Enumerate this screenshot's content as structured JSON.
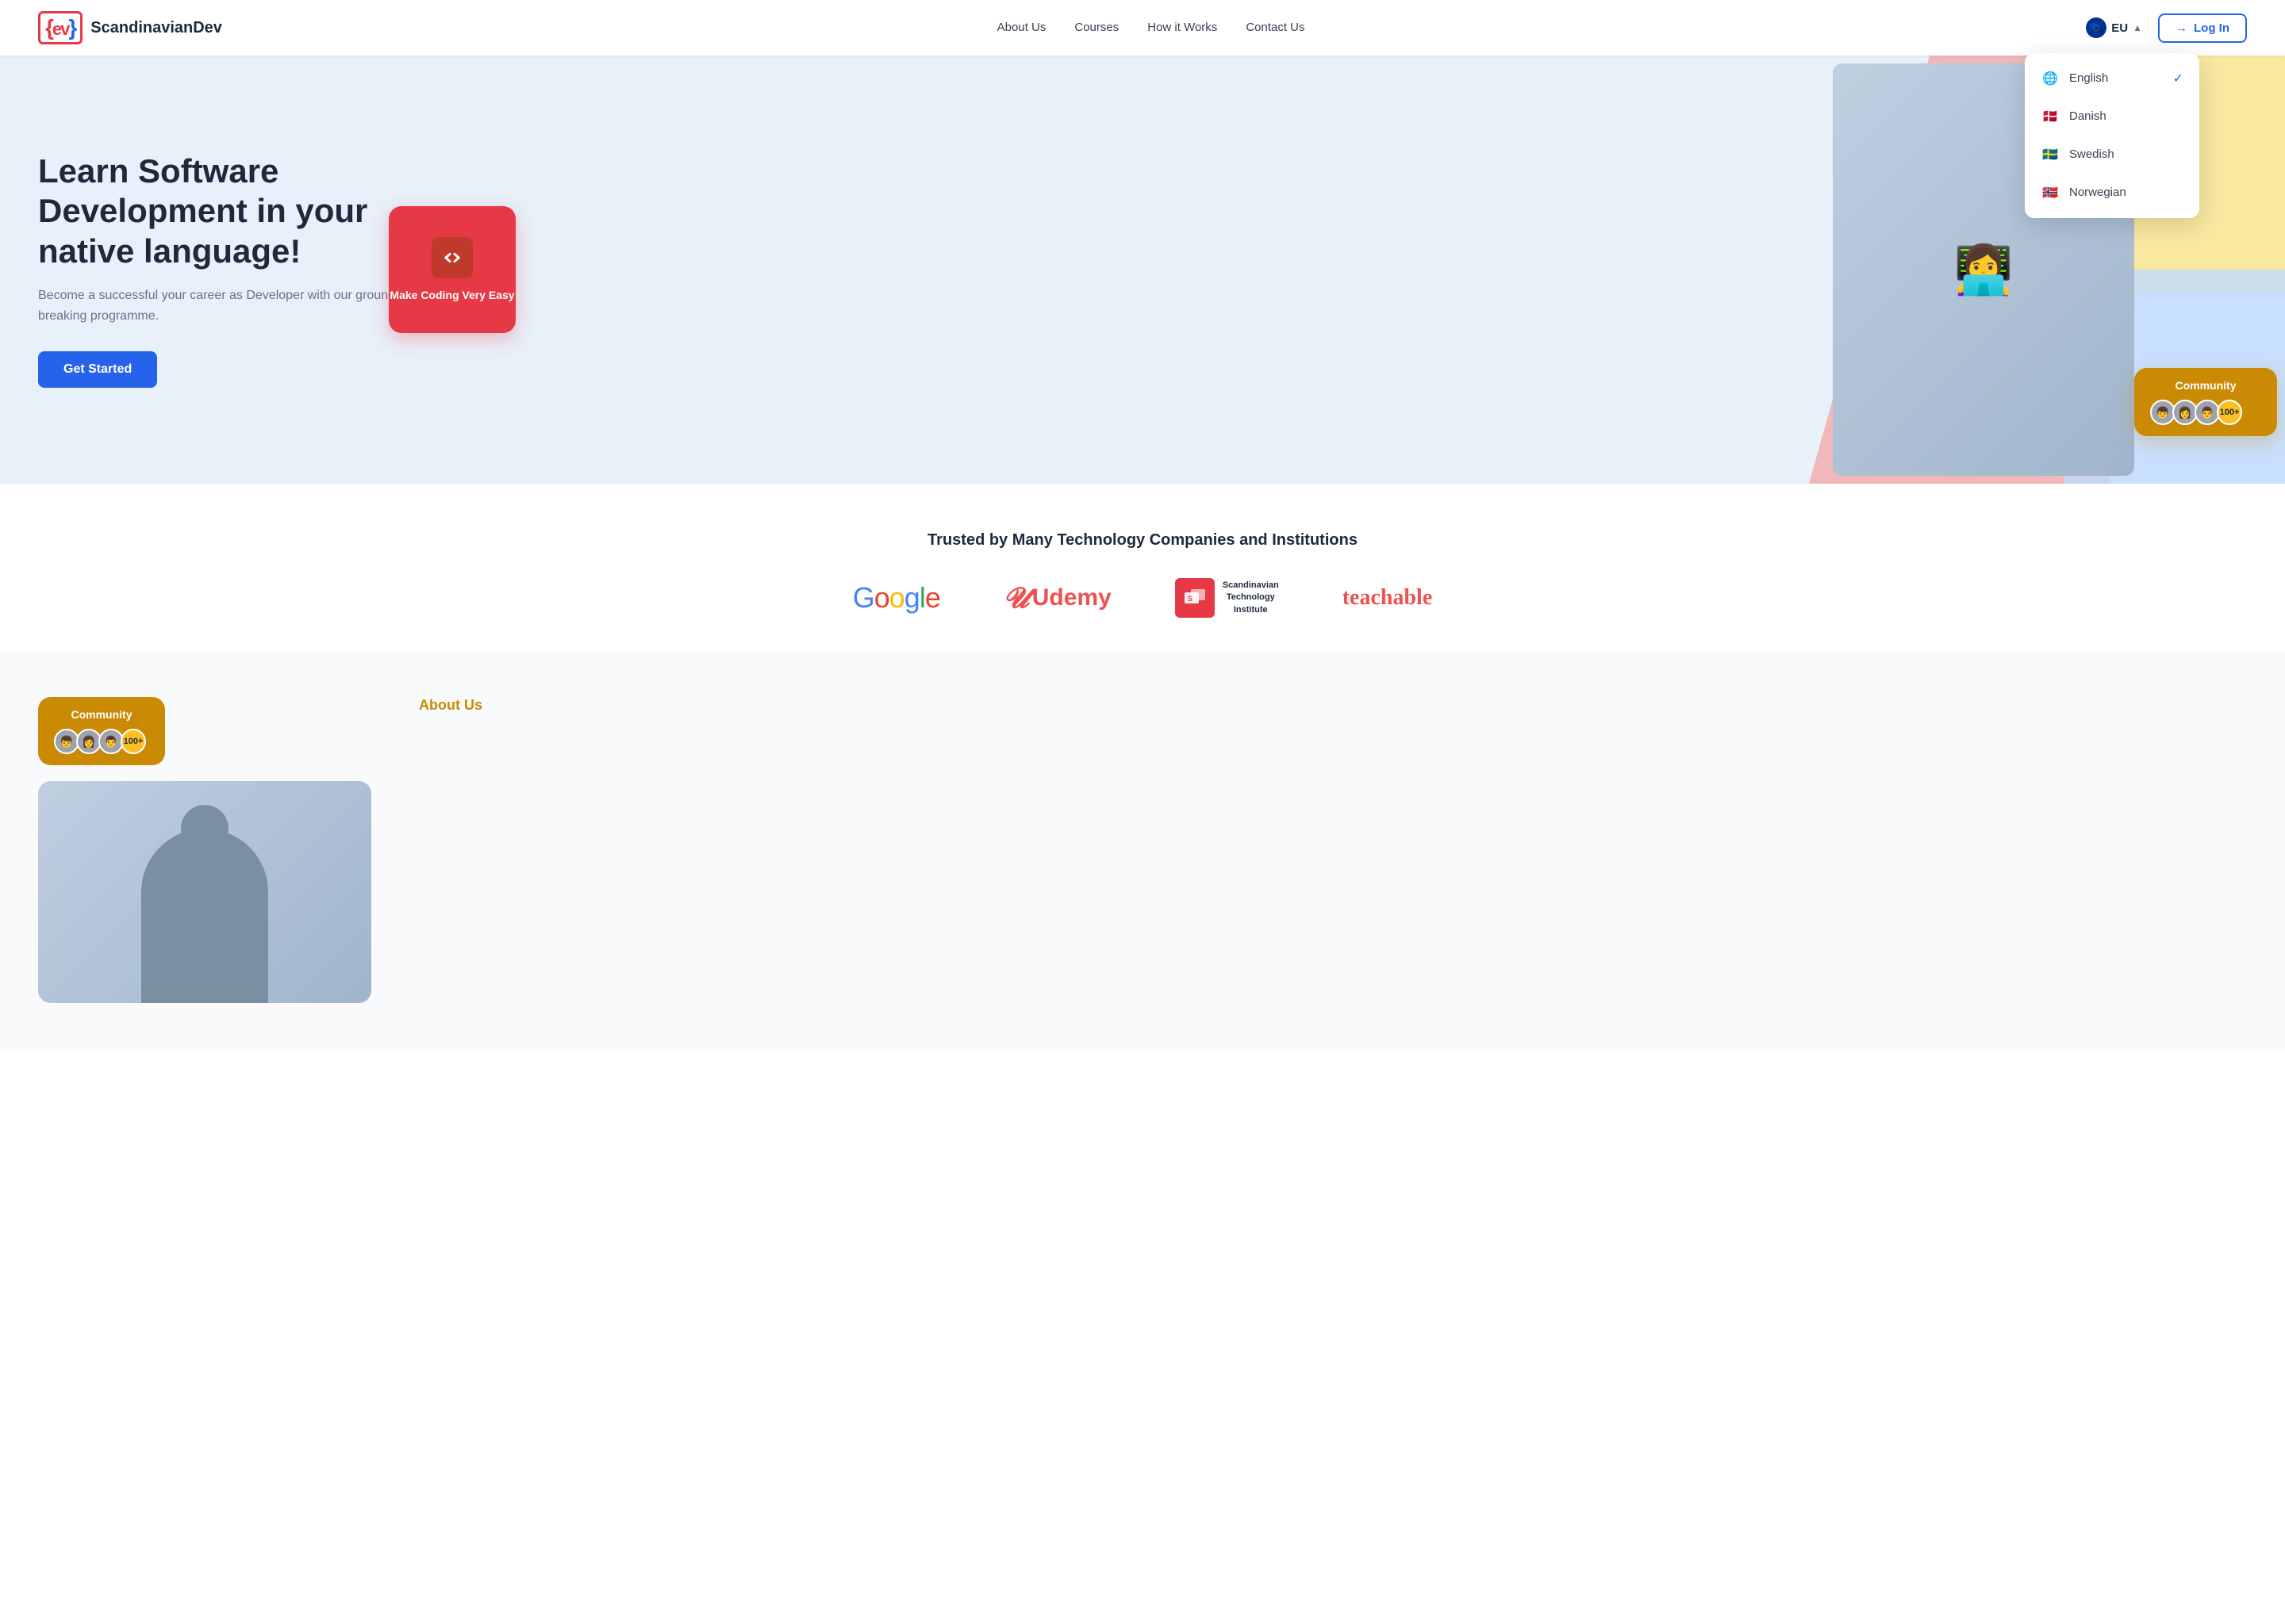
{
  "brand": {
    "name": "ScandinavianDev",
    "logo_icon": "{ev}"
  },
  "navbar": {
    "links": [
      {
        "label": "About Us",
        "id": "about-us"
      },
      {
        "label": "Courses",
        "id": "courses"
      },
      {
        "label": "How it Works",
        "id": "how-it-works"
      },
      {
        "label": "Contact Us",
        "id": "contact-us"
      }
    ],
    "language_button": "EU",
    "login_label": "Log In"
  },
  "language_dropdown": {
    "items": [
      {
        "label": "English",
        "selected": true,
        "flag": "🌐"
      },
      {
        "label": "Danish",
        "selected": false,
        "flag": "🇩🇰"
      },
      {
        "label": "Swedish",
        "selected": false,
        "flag": "🇸🇪"
      },
      {
        "label": "Norwegian",
        "selected": false,
        "flag": "🇳🇴"
      }
    ]
  },
  "hero": {
    "title": "Learn Software Development in your native language!",
    "subtitle": "Become a successful your career as Developer with our ground-breaking programme.",
    "cta_label": "Get Started",
    "coding_card": {
      "title": "Make Coding Very Easy"
    },
    "community_card": {
      "title": "Community",
      "count": "100+"
    }
  },
  "trusted": {
    "title": "Trusted by Many Technology Companies and Institutions",
    "logos": [
      {
        "name": "Google"
      },
      {
        "name": "Udemy"
      },
      {
        "name": "Scandinavian Technology Institute"
      },
      {
        "name": "teachable"
      }
    ]
  },
  "bottom": {
    "community_card": {
      "title": "Community",
      "count": "100+"
    },
    "about_us_label": "About Us"
  }
}
